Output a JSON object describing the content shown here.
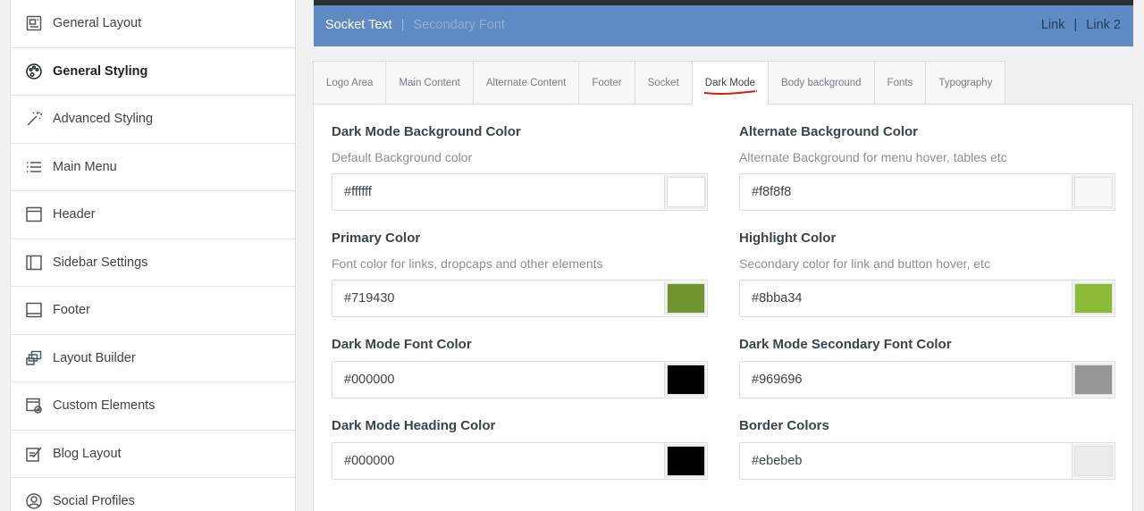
{
  "sidebar": {
    "items": [
      {
        "label": "General Layout",
        "icon": "layout-icon",
        "active": false
      },
      {
        "label": "General Styling",
        "icon": "palette-icon",
        "active": true
      },
      {
        "label": "Advanced Styling",
        "icon": "magic-wand-icon",
        "active": false
      },
      {
        "label": "Main Menu",
        "icon": "list-icon",
        "active": false
      },
      {
        "label": "Header",
        "icon": "header-icon",
        "active": false
      },
      {
        "label": "Sidebar Settings",
        "icon": "sidebar-icon",
        "active": false
      },
      {
        "label": "Footer",
        "icon": "footer-icon",
        "active": false
      },
      {
        "label": "Layout Builder",
        "icon": "layers-icon",
        "active": false
      },
      {
        "label": "Custom Elements",
        "icon": "custom-elements-icon",
        "active": false
      },
      {
        "label": "Blog Layout",
        "icon": "edit-icon",
        "active": false
      },
      {
        "label": "Social Profiles",
        "icon": "user-icon",
        "active": false
      }
    ]
  },
  "preview": {
    "socket_text": "Socket Text",
    "separator": "|",
    "secondary_font": "Secondary Font",
    "link1": "Link",
    "link2": "Link 2",
    "bar_color": "#5f8ac4"
  },
  "tabs": [
    {
      "label": "Logo Area",
      "active": false
    },
    {
      "label": "Main Content",
      "active": false
    },
    {
      "label": "Alternate Content",
      "active": false
    },
    {
      "label": "Footer",
      "active": false
    },
    {
      "label": "Socket",
      "active": false
    },
    {
      "label": "Dark Mode",
      "active": true
    },
    {
      "label": "Body background",
      "active": false
    },
    {
      "label": "Fonts",
      "active": false
    },
    {
      "label": "Typography",
      "active": false
    }
  ],
  "fields": {
    "dark_bg": {
      "title": "Dark Mode Background Color",
      "desc": "Default Background color",
      "value": "#ffffff",
      "swatch": "#ffffff"
    },
    "alt_bg": {
      "title": "Alternate Background Color",
      "desc": "Alternate Background for menu hover, tables etc",
      "value": "#f8f8f8",
      "swatch": "#f8f8f8"
    },
    "primary": {
      "title": "Primary Color",
      "desc": "Font color for links, dropcaps and other elements",
      "value": "#719430",
      "swatch": "#719430"
    },
    "highlight": {
      "title": "Highlight Color",
      "desc": "Secondary color for link and button hover, etc",
      "value": "#8bba34",
      "swatch": "#8bba34"
    },
    "font": {
      "title": "Dark Mode Font Color",
      "value": "#000000",
      "swatch": "#000000"
    },
    "secondary_font": {
      "title": "Dark Mode Secondary Font Color",
      "value": "#969696",
      "swatch": "#969696"
    },
    "heading": {
      "title": "Dark Mode Heading Color",
      "value": "#000000",
      "swatch": "#000000"
    },
    "border": {
      "title": "Border Colors",
      "value": "#ebebeb",
      "swatch": "#ebebeb"
    }
  }
}
